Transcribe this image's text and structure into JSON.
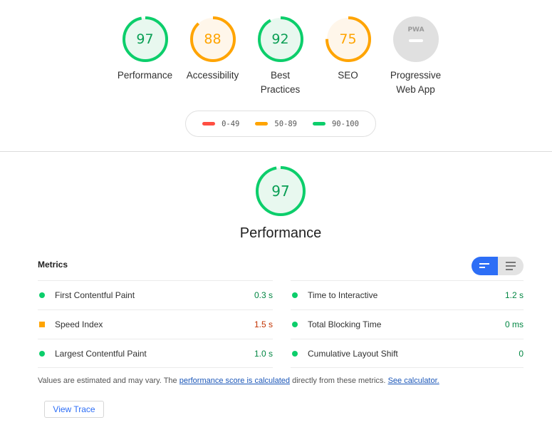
{
  "colors": {
    "pass": "#0cce6b",
    "pass_text": "#018642",
    "pass_bg": "#e8f8ef",
    "average": "#ffa400",
    "average_text": "#c33300",
    "average_bg": "#fff6ea",
    "fail": "#ff4e42",
    "neutral_bg": "#e0e0e0",
    "accent": "#2d6ef6"
  },
  "gauges": [
    {
      "label": "Performance",
      "score": "97",
      "value": 97,
      "rating": "pass"
    },
    {
      "label": "Accessibility",
      "score": "88",
      "value": 88,
      "rating": "average"
    },
    {
      "label": "Best Practices",
      "score": "92",
      "value": 92,
      "rating": "pass"
    },
    {
      "label": "SEO",
      "score": "75",
      "value": 75,
      "rating": "average"
    },
    {
      "label": "Progressive Web App",
      "badge": "PWA",
      "rating": "na"
    }
  ],
  "legend": [
    {
      "range": "0-49",
      "rating": "fail"
    },
    {
      "range": "50-89",
      "rating": "average"
    },
    {
      "range": "90-100",
      "rating": "pass"
    }
  ],
  "category": {
    "title": "Performance",
    "score": "97",
    "value": 97
  },
  "metrics": {
    "header": "Metrics",
    "left": [
      {
        "name": "First Contentful Paint",
        "value": "0.3 s",
        "rating": "pass"
      },
      {
        "name": "Speed Index",
        "value": "1.5 s",
        "rating": "average"
      },
      {
        "name": "Largest Contentful Paint",
        "value": "1.0 s",
        "rating": "pass"
      }
    ],
    "right": [
      {
        "name": "Time to Interactive",
        "value": "1.2 s",
        "rating": "pass"
      },
      {
        "name": "Total Blocking Time",
        "value": "0 ms",
        "rating": "pass"
      },
      {
        "name": "Cumulative Layout Shift",
        "value": "0",
        "rating": "pass"
      }
    ]
  },
  "footnote": {
    "prefix": "Values are estimated and may vary. The ",
    "link1": "performance score is calculated",
    "middle": " directly from these metrics. ",
    "link2": "See calculator."
  },
  "view_trace_label": "View Trace"
}
